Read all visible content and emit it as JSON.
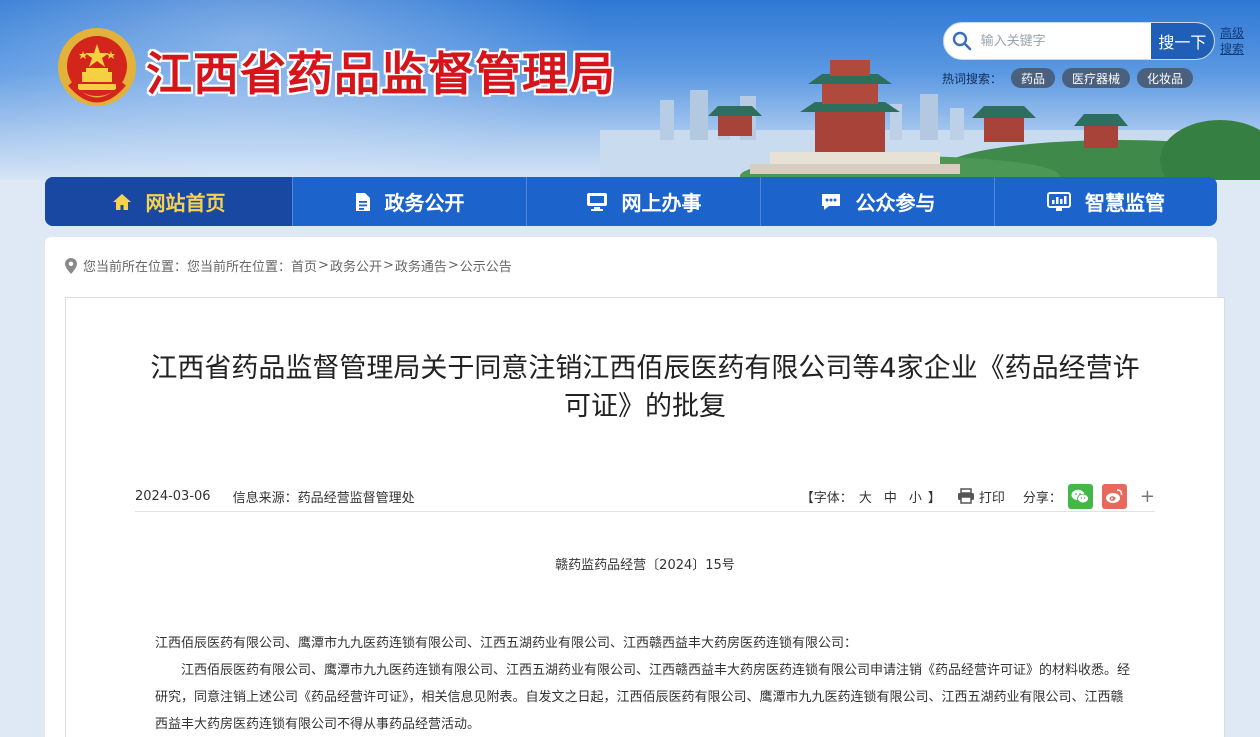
{
  "header": {
    "site_title": "江西省药品监督管理局",
    "search": {
      "placeholder": "输入关键字",
      "button_label": "搜一下",
      "advanced_label": "高级搜索"
    },
    "hot_search": {
      "label": "热词搜索：",
      "tags": [
        "药品",
        "医疗器械",
        "化妆品"
      ]
    }
  },
  "nav": {
    "items": [
      {
        "label": "网站首页",
        "icon": "home-icon",
        "active": true
      },
      {
        "label": "政务公开",
        "icon": "document-icon"
      },
      {
        "label": "网上办事",
        "icon": "monitor-icon"
      },
      {
        "label": "公众参与",
        "icon": "chat-icon"
      },
      {
        "label": "智慧监管",
        "icon": "dashboard-icon"
      }
    ]
  },
  "breadcrumb": {
    "prefix": "您当前所在位置：您当前所在位置：",
    "items": [
      "首页",
      "政务公开",
      "政务通告",
      "公示公告"
    ],
    "separator": ">"
  },
  "article": {
    "title": "江西省药品监督管理局关于同意注销江西佰辰医药有限公司等4家企业《药品经营许可证》的批复",
    "date": "2024-03-06",
    "source": "信息来源：药品经营监督管理处",
    "font_ctrl": {
      "prefix": "【字体：",
      "large": "大",
      "medium": "中",
      "small": "小",
      "suffix": "】"
    },
    "print_label": "打印",
    "share_label": "分享：",
    "doc_number": "赣药监药品经营〔2024〕15号",
    "recipients": "江西佰辰医药有限公司、鹰潭市九九医药连锁有限公司、江西五湖药业有限公司、江西赣西益丰大药房医药连锁有限公司：",
    "paragraph": "江西佰辰医药有限公司、鹰潭市九九医药连锁有限公司、江西五湖药业有限公司、江西赣西益丰大药房医药连锁有限公司申请注销《药品经营许可证》的材料收悉。经研究，同意注销上述公司《药品经营许可证》，相关信息见附表。自发文之日起，江西佰辰医药有限公司、鹰潭市九九医药连锁有限公司、江西五湖药业有限公司、江西赣西益丰大药房医药连锁有限公司不得从事药品经营活动。"
  },
  "colors": {
    "brand_red": "#d5141c",
    "nav_blue": "#1c63cc",
    "nav_active": "#1848a2",
    "nav_active_text": "#f6d24d"
  }
}
